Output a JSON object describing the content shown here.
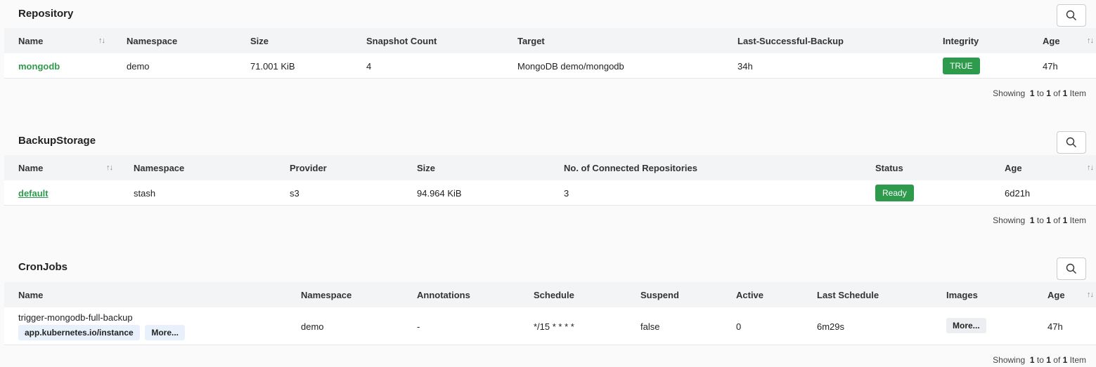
{
  "repository": {
    "title": "Repository",
    "columns": [
      "Name",
      "Namespace",
      "Size",
      "Snapshot Count",
      "Target",
      "Last-Successful-Backup",
      "Integrity",
      "Age"
    ],
    "rows": [
      {
        "name": "mongodb",
        "namespace": "demo",
        "size": "71.001 KiB",
        "snapshot_count": "4",
        "target": "MongoDB demo/mongodb",
        "last_backup": "34h",
        "integrity": "TRUE",
        "age": "47h"
      }
    ],
    "pager": {
      "prefix": "Showing",
      "from": "1",
      "to_word": "to",
      "to": "1",
      "of_word": "of",
      "total": "1",
      "suffix": "Item"
    }
  },
  "backup_storage": {
    "title": "BackupStorage",
    "columns": [
      "Name",
      "Namespace",
      "Provider",
      "Size",
      "No. of Connected Repositories",
      "Status",
      "Age"
    ],
    "rows": [
      {
        "name": "default",
        "namespace": "stash",
        "provider": "s3",
        "size": "94.964 KiB",
        "connected": "3",
        "status": "Ready",
        "age": "6d21h"
      }
    ],
    "pager": {
      "prefix": "Showing",
      "from": "1",
      "to_word": "to",
      "to": "1",
      "of_word": "of",
      "total": "1",
      "suffix": "Item"
    }
  },
  "cronjobs": {
    "title": "CronJobs",
    "columns": [
      "Name",
      "Namespace",
      "Annotations",
      "Schedule",
      "Suspend",
      "Active",
      "Last Schedule",
      "Images",
      "Age"
    ],
    "rows": [
      {
        "name": "trigger-mongodb-full-backup",
        "label_chip": "app.kubernetes.io/instance",
        "more_chip": "More...",
        "namespace": "demo",
        "annotations": "-",
        "schedule": "*/15 * * * *",
        "suspend": "false",
        "active": "0",
        "last_schedule": "6m29s",
        "images_more": "More...",
        "age": "47h"
      }
    ],
    "pager": {
      "prefix": "Showing",
      "from": "1",
      "to_word": "to",
      "to": "1",
      "of_word": "of",
      "total": "1",
      "suffix": "Item"
    }
  },
  "icons": {
    "search": "search-icon",
    "sort": "sort-icon"
  },
  "colors": {
    "accent_green": "#2e9b4c",
    "header_bg": "#f3f4f6",
    "chip_bg": "#e8f1fb"
  },
  "sort_glyph": "↑↓"
}
